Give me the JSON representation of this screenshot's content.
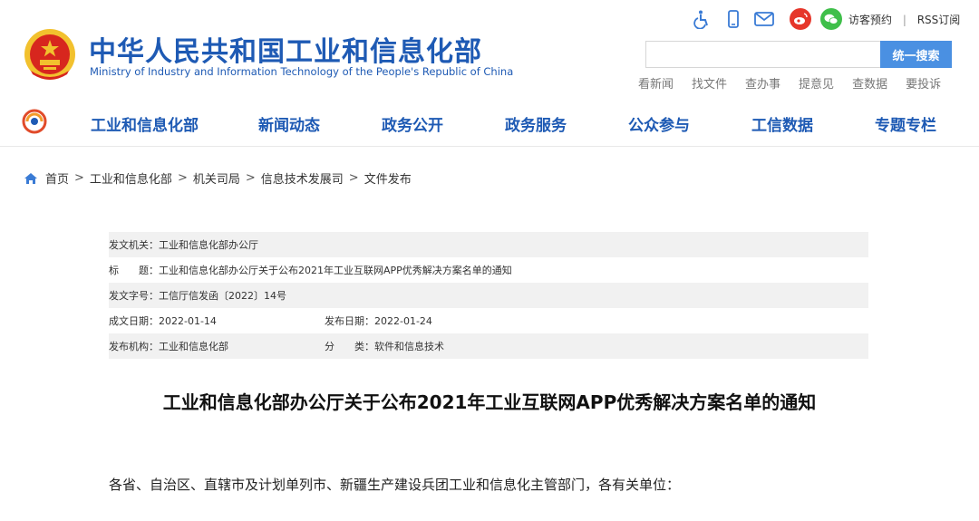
{
  "header": {
    "title_cn": "中华人民共和国工业和信息化部",
    "title_en": "Ministry of Industry and Information Technology of the People's Republic of China",
    "icons": [
      "accessibility-icon",
      "mobile-icon",
      "mail-icon",
      "weibo-icon",
      "wechat-icon"
    ],
    "visitor_booking": "访客预约",
    "separator": "|",
    "rss": "RSS订阅",
    "search": {
      "value": "",
      "placeholder": "",
      "button_label": "统一搜索"
    },
    "quick_links": [
      "看新闻",
      "找文件",
      "查办事",
      "提意见",
      "查数据",
      "要投诉"
    ]
  },
  "nav": {
    "items": [
      "工业和信息化部",
      "新闻动态",
      "政务公开",
      "政务服务",
      "公众参与",
      "工信数据",
      "专题专栏"
    ]
  },
  "breadcrumb": {
    "items": [
      "首页",
      "工业和信息化部",
      "机关司局",
      "信息技术发展司",
      "文件发布"
    ],
    "separator": ">"
  },
  "meta": {
    "issuer": "发文机关：工业和信息化部办公厅",
    "title": "标　　题：工业和信息化部办公厅关于公布2021年工业互联网APP优秀解决方案名单的通知",
    "doc_number": "发文字号：工信厅信发函〔2022〕14号",
    "created_date": "成文日期：2022-01-14",
    "published_date": "发布日期：2022-01-24",
    "publisher": "发布机构：工业和信息化部",
    "category": "分　　类：软件和信息技术"
  },
  "article": {
    "title": "工业和信息化部办公厅关于公布2021年工业互联网APP优秀解决方案名单的通知",
    "greeting": "各省、自治区、直辖市及计划单列市、新疆生产建设兵团工业和信息化主管部门，各有关单位："
  },
  "colors": {
    "brand_blue": "#1e5ab4",
    "search_button": "#4a90e2",
    "emblem_red": "#d7261e",
    "emblem_gold": "#f2c12e",
    "weibo_red": "#e6362a",
    "wechat_green": "#3fbf4a"
  }
}
